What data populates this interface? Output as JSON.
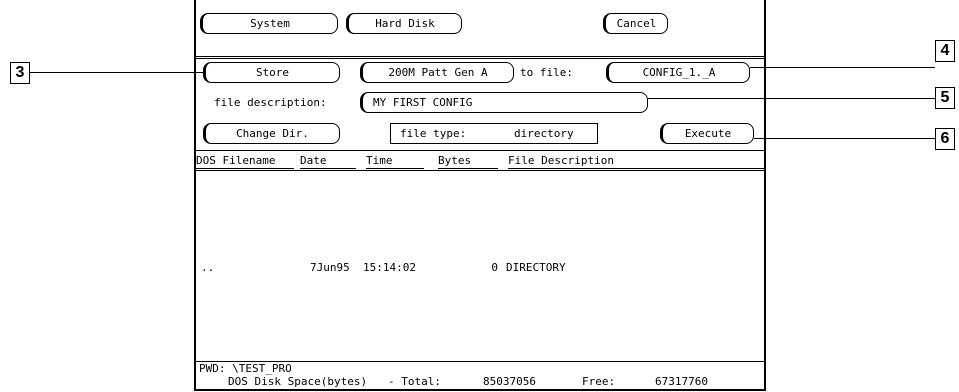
{
  "top_bar": {
    "system_label": "System",
    "hard_disk_label": "Hard Disk",
    "cancel_label": "Cancel"
  },
  "store_row": {
    "store_label": "Store",
    "source_label": "200M Patt Gen A",
    "to_file_label": "to file:",
    "filename_value": "CONFIG_1._A"
  },
  "description_row": {
    "label": "file description:",
    "value": "MY FIRST CONFIG"
  },
  "action_row": {
    "change_dir_label": "Change Dir.",
    "file_type_label": "file type:",
    "file_type_value": "directory",
    "execute_label": "Execute"
  },
  "table": {
    "headers": [
      "DOS Filename",
      "Date",
      "Time",
      "Bytes",
      "File Description"
    ],
    "rows": [
      {
        "filename": "..",
        "date": "7Jun95",
        "time": "15:14:02",
        "bytes": "0",
        "description": "DIRECTORY"
      }
    ]
  },
  "footer": {
    "pwd": "PWD: \\TEST_PRO",
    "disk_space_label": "DOS Disk Space(bytes)",
    "total_label": "- Total:",
    "total_value": "85037056",
    "free_label": "Free:",
    "free_value": "67317760"
  },
  "callouts": {
    "c3": "3",
    "c4": "4",
    "c5": "5",
    "c6": "6"
  }
}
